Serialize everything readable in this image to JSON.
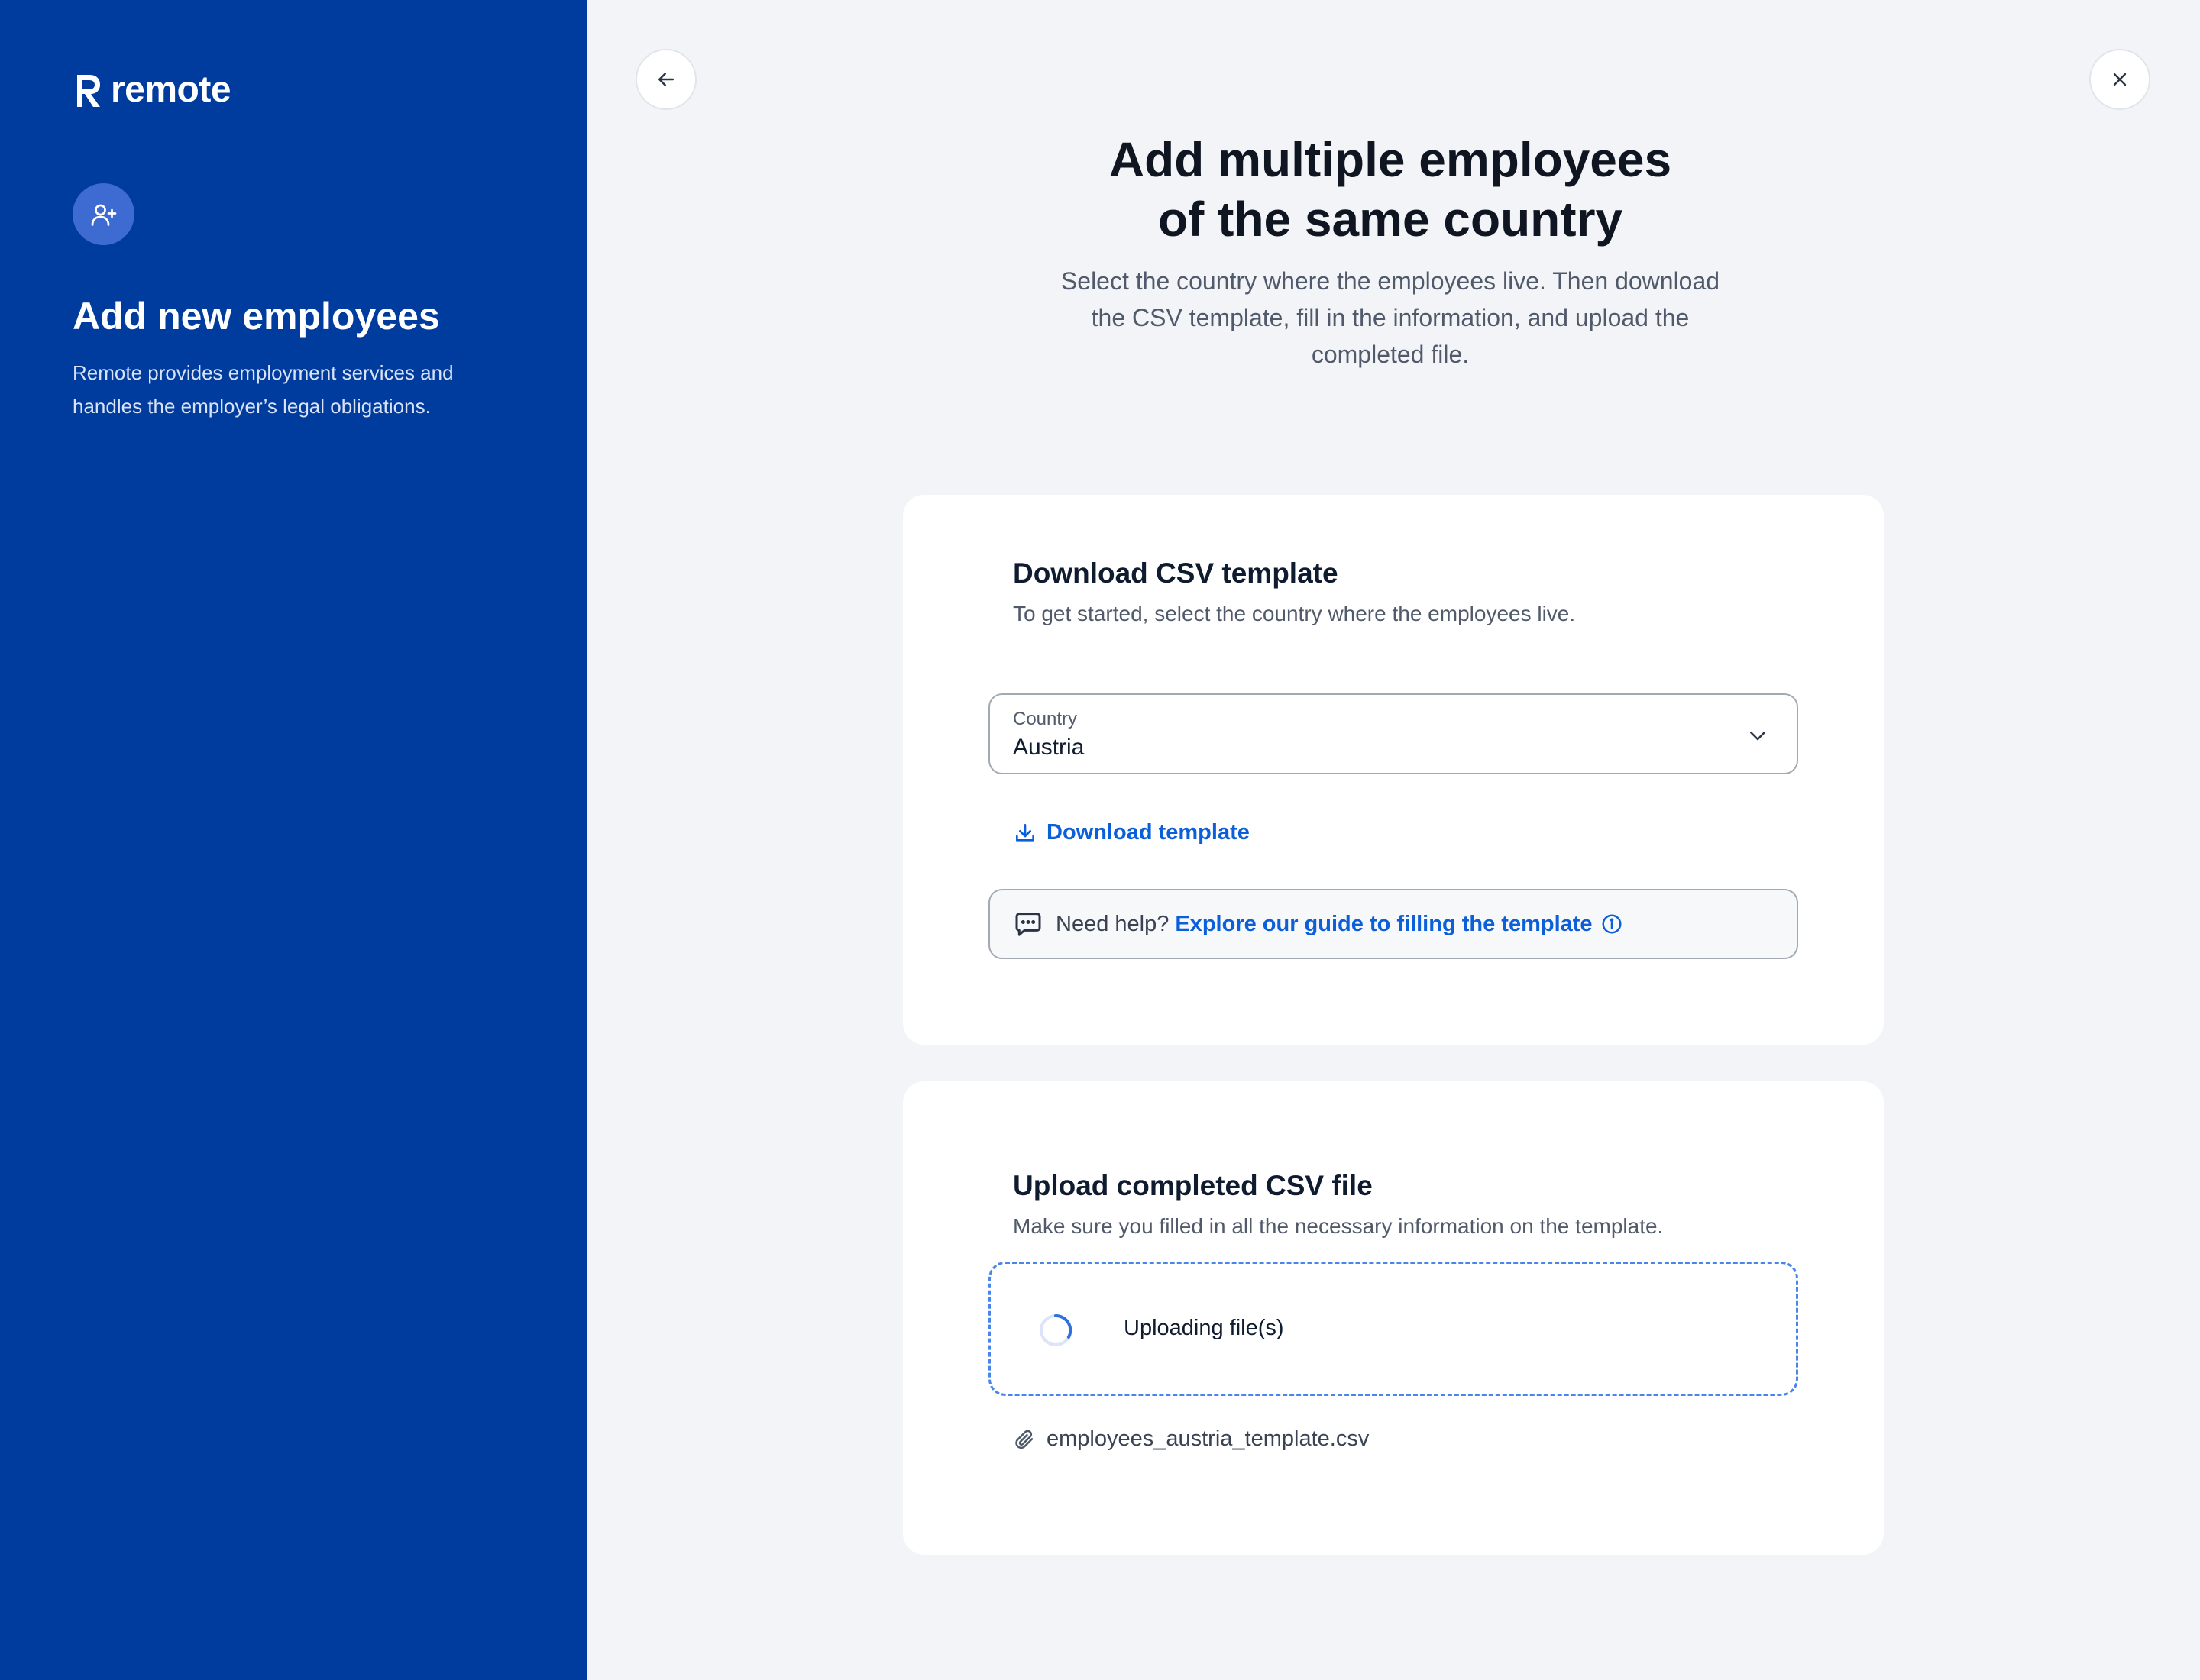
{
  "brand": {
    "name": "remote",
    "sidebar_color": "#003b9e",
    "accent": "#0b5fd9"
  },
  "sidebar": {
    "avatar_icon": "user-plus-icon",
    "title": "Add new employees",
    "description": "Remote provides employment services and handles the employer’s legal obligations."
  },
  "nav": {
    "back_icon": "arrow-left-icon",
    "close_icon": "close-icon"
  },
  "header": {
    "title_line1": "Add multiple employees",
    "title_line2": "of the same country",
    "subtitle": "Select the country where the employees live. Then download the CSV template, fill in the information, and upload the completed file."
  },
  "download_card": {
    "title": "Download CSV template",
    "subtitle": "To get started, select the country where the employees live.",
    "country_label": "Country",
    "country_value": "Austria",
    "download_label": "Download template",
    "help_prefix": "Need help?",
    "help_link": "Explore our guide to filling the template"
  },
  "upload_card": {
    "title": "Upload completed CSV file",
    "subtitle": "Make sure you filled in all the necessary information on the template.",
    "status_text": "Uploading file(s)",
    "file_name": "employees_austria_template.csv"
  }
}
